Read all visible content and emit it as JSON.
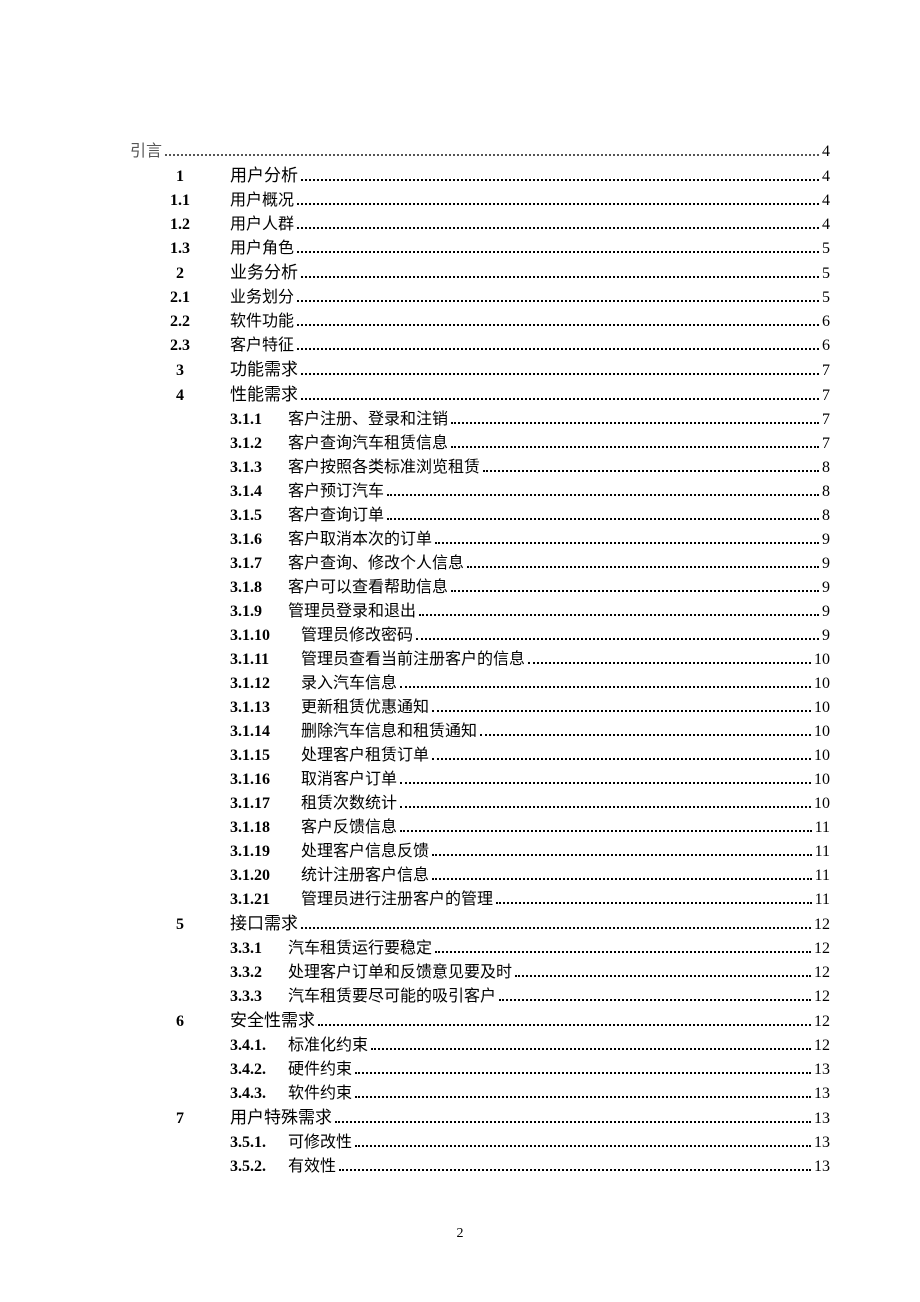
{
  "pageNumber": "2",
  "intro": {
    "label": "引言",
    "page": "4"
  },
  "entries": [
    {
      "n": "1",
      "t": "用户分析",
      "p": "4",
      "cls": "chapter"
    },
    {
      "n": "1.1",
      "t": "用户概况",
      "p": "4"
    },
    {
      "n": "1.2",
      "t": "用户人群",
      "p": "4"
    },
    {
      "n": "1.3",
      "t": "用户角色",
      "p": "5"
    },
    {
      "n": "2",
      "t": "业务分析",
      "p": "5",
      "cls": "chapter"
    },
    {
      "n": "2.1",
      "t": "业务划分",
      "p": "5"
    },
    {
      "n": "2.2",
      "t": "软件功能",
      "p": "6"
    },
    {
      "n": "2.3",
      "t": "客户特征",
      "p": "6"
    },
    {
      "n": "3",
      "t": "功能需求",
      "p": "7",
      "cls": "chapter"
    },
    {
      "n": "4",
      "t": "性能需求",
      "p": "7",
      "cls": "chapter",
      "gap": true
    },
    {
      "s": "3.1.1",
      "t": "客户注册、登录和注销",
      "p": "7",
      "gap": true
    },
    {
      "s": "3.1.2",
      "t": "客户查询汽车租赁信息",
      "p": "7",
      "gap": true
    },
    {
      "s": "3.1.3",
      "t": "客户按照各类标准浏览租赁",
      "p": "8",
      "gap": true
    },
    {
      "s": "3.1.4",
      "t": "客户预订汽车",
      "p": "8",
      "gap": true
    },
    {
      "s": "3.1.5",
      "t": "客户查询订单",
      "p": "8",
      "gap": true
    },
    {
      "s": "3.1.6",
      "t": "客户取消本次的订单",
      "p": "9",
      "gap": true
    },
    {
      "s": "3.1.7",
      "t": "客户查询、修改个人信息",
      "p": "9",
      "gap": true
    },
    {
      "s": "3.1.8",
      "t": "客户可以查看帮助信息",
      "p": "9",
      "gap": true
    },
    {
      "s": "3.1.9",
      "t": "管理员登录和退出",
      "p": "9",
      "gap": true
    },
    {
      "s": "3.1.10",
      "t": "管理员修改密码",
      "p": "9",
      "gap": true,
      "w": "w2"
    },
    {
      "s": "3.1.11",
      "t": "管理员查看当前注册客户的信息",
      "p": "10",
      "w": "w2"
    },
    {
      "s": "3.1.12",
      "t": "录入汽车信息",
      "p": "10",
      "gap": true,
      "w": "w2"
    },
    {
      "s": "3.1.13",
      "t": "更新租赁优惠通知",
      "p": "10",
      "gap": true,
      "w": "w2"
    },
    {
      "s": "3.1.14",
      "t": "删除汽车信息和租赁通知",
      "p": "10",
      "gap": true,
      "w": "w2"
    },
    {
      "s": "3.1.15",
      "t": "处理客户租赁订单",
      "p": "10",
      "gap": true,
      "w": "w2"
    },
    {
      "s": "3.1.16",
      "t": "取消客户订单",
      "p": "10",
      "gap": true,
      "w": "w2"
    },
    {
      "s": "3.1.17",
      "t": "租赁次数统计",
      "p": "10",
      "gap": true,
      "w": "w2"
    },
    {
      "s": "3.1.18",
      "t": "客户反馈信息",
      "p": "11",
      "gap": true,
      "w": "w2"
    },
    {
      "s": "3.1.19",
      "t": "处理客户信息反馈",
      "p": "11",
      "gap": true,
      "w": "w2"
    },
    {
      "s": "3.1.20",
      "t": "统计注册客户信息",
      "p": "11",
      "gap": true,
      "w": "w2"
    },
    {
      "s": "3.1.21",
      "t": "管理员进行注册客户的管理",
      "p": "11",
      "gap": true,
      "w": "w2"
    },
    {
      "n": "5",
      "t": "接口需求",
      "p": "12",
      "cls": "chapter",
      "gap": true
    },
    {
      "s": "3.3.1",
      "t": "汽车租赁运行要稳定",
      "p": "12",
      "gap": true
    },
    {
      "s": "3.3.2",
      "t": "处理客户订单和反馈意见要及时",
      "p": "12",
      "gap": true
    },
    {
      "s": "3.3.3",
      "t": "汽车租赁要尽可能的吸引客户",
      "p": "12",
      "gap": true
    },
    {
      "n": "6",
      "t": "安全性需求",
      "p": "12",
      "cls": "chapter",
      "gap": true
    },
    {
      "s": "3.4.1.",
      "t": "标准化约束",
      "p": "12",
      "gap": true
    },
    {
      "s": "3.4.2.",
      "t": "硬件约束",
      "p": "13",
      "gap": true
    },
    {
      "s": "3.4.3.",
      "t": "软件约束",
      "p": "13",
      "gap": true
    },
    {
      "n": "7",
      "t": "用户特殊需求",
      "p": "13",
      "cls": "chapter",
      "gap": true
    },
    {
      "s": "3.5.1.",
      "t": "可修改性",
      "p": "13",
      "gap": true
    },
    {
      "s": "3.5.2.",
      "t": "有效性",
      "p": "13",
      "gap": true
    }
  ]
}
